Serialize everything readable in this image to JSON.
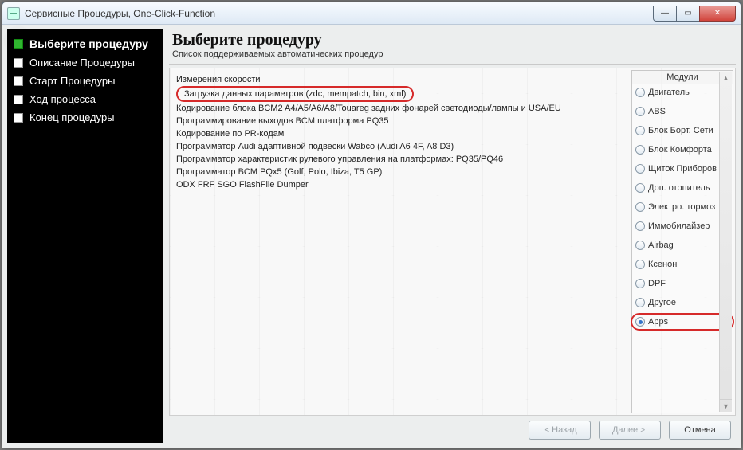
{
  "window_title": "Сервисные Процедуры, One-Click-Function",
  "sidebar": {
    "steps": [
      {
        "label": "Выберите процедуру",
        "active": true
      },
      {
        "label": "Описание Процедуры",
        "active": false
      },
      {
        "label": "Старт Процедуры",
        "active": false
      },
      {
        "label": "Ход процесса",
        "active": false
      },
      {
        "label": "Конец процедуры",
        "active": false
      }
    ]
  },
  "main": {
    "title": "Выберите процедуру",
    "subtitle": "Список поддерживаемых автоматических процедур",
    "procedures": [
      {
        "text": "Измерения скорости",
        "highlight": false
      },
      {
        "text": "Загрузка данных параметров (zdc, mempatch, bin, xml)",
        "highlight": true
      },
      {
        "text": "Кодирование блока  BCM2 A4/A5/A6/A8/Touareg  задних фонарей светодиоды/лампы и  USA/EU",
        "highlight": false
      },
      {
        "text": "Программирование выходов BCM платформа PQ35",
        "highlight": false
      },
      {
        "text": "Кодирование по PR-кодам",
        "highlight": false
      },
      {
        "text": "Программатор Audi адаптивной подвески Wabco (Audi A6 4F, A8 D3)",
        "highlight": false
      },
      {
        "text": "Программатор характеристик рулевого управления на платформах: PQ35/PQ46",
        "highlight": false
      },
      {
        "text": "Программатор BCM PQx5 (Golf, Polo, Ibiza, T5 GP)",
        "highlight": false
      },
      {
        "text": "ODX FRF SGO FlashFile Dumper",
        "highlight": false
      }
    ]
  },
  "moduly": {
    "title": "Модули",
    "items": [
      {
        "label": "Двигатель",
        "selected": false,
        "circled": false
      },
      {
        "label": "ABS",
        "selected": false,
        "circled": false
      },
      {
        "label": "Блок Борт. Сети",
        "selected": false,
        "circled": false
      },
      {
        "label": "Блок Комфорта",
        "selected": false,
        "circled": false
      },
      {
        "label": "Щиток Приборов",
        "selected": false,
        "circled": false
      },
      {
        "label": "Доп. отопитель",
        "selected": false,
        "circled": false
      },
      {
        "label": "Электро. тормоз",
        "selected": false,
        "circled": false
      },
      {
        "label": "Иммобилайзер",
        "selected": false,
        "circled": false
      },
      {
        "label": "Airbag",
        "selected": false,
        "circled": false
      },
      {
        "label": "Ксенон",
        "selected": false,
        "circled": false
      },
      {
        "label": "DPF",
        "selected": false,
        "circled": false
      },
      {
        "label": "Другое",
        "selected": false,
        "circled": false
      },
      {
        "label": "Apps",
        "selected": true,
        "circled": true
      }
    ]
  },
  "footer": {
    "back": "Назад",
    "next": "Далее",
    "cancel": "Отмена"
  }
}
